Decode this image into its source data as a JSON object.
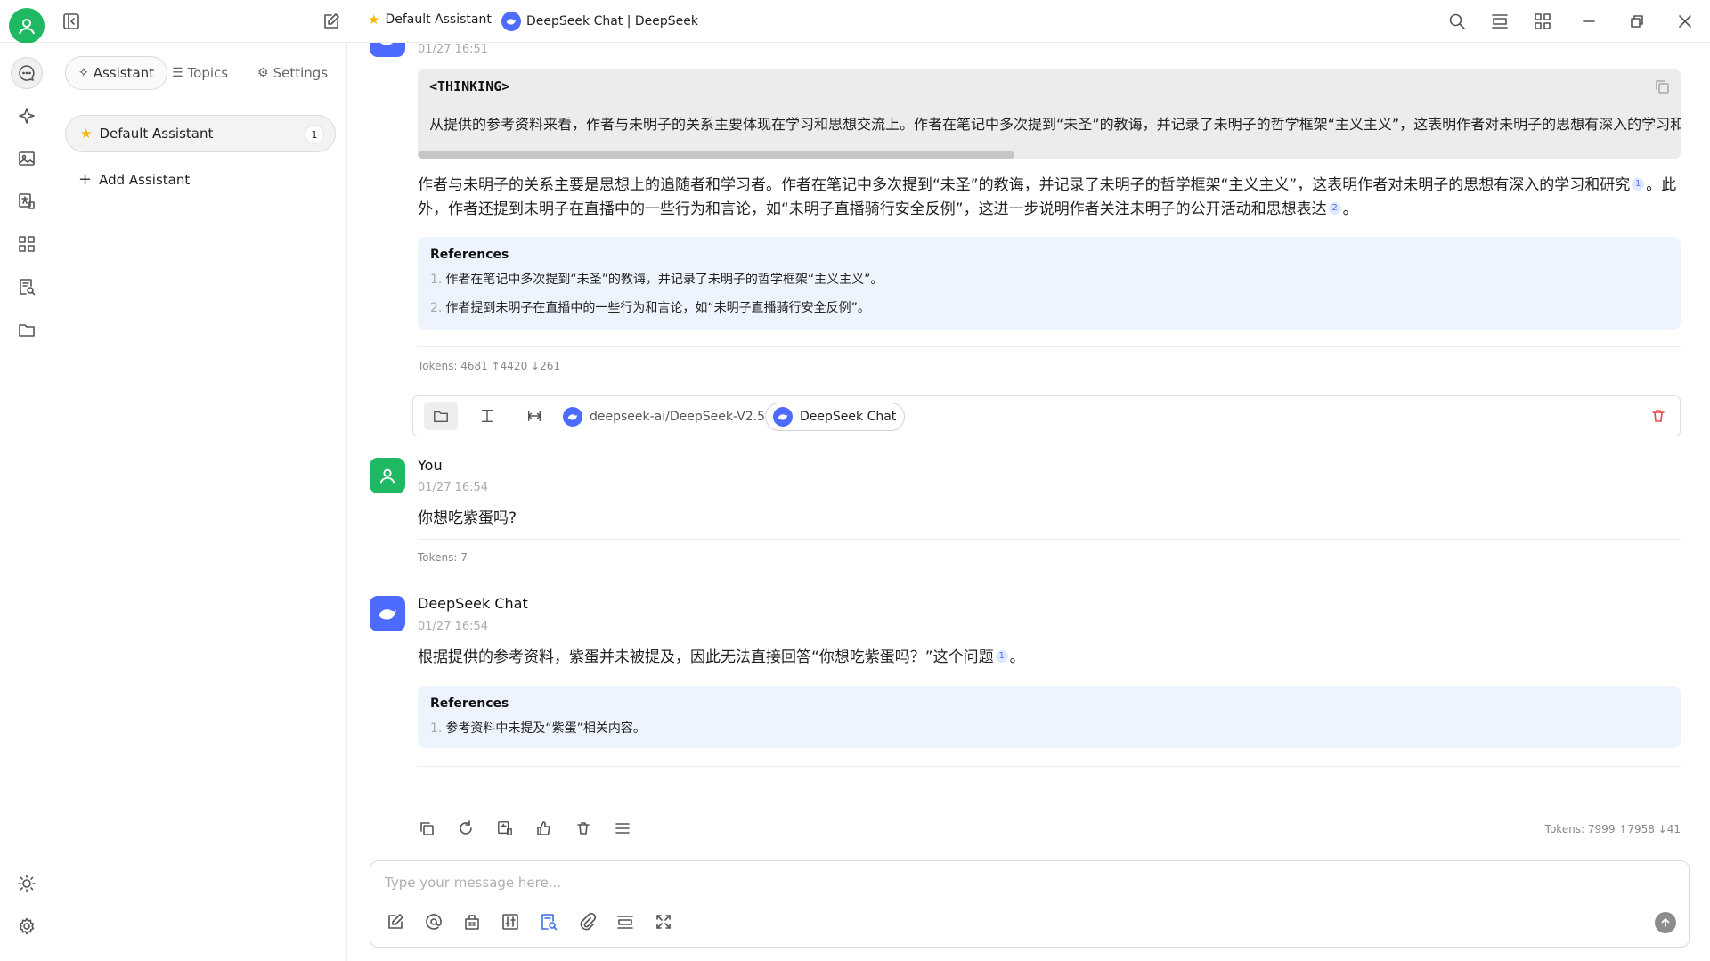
{
  "titlebar": {
    "assistant_tab": "Default Assistant",
    "chat_tab": "DeepSeek Chat | DeepSeek"
  },
  "panel": {
    "tabs": [
      {
        "label": "Assistant"
      },
      {
        "label": "Topics"
      },
      {
        "label": "Settings"
      }
    ],
    "assistant": {
      "name": "Default Assistant",
      "count": "1"
    },
    "add_label": "Add Assistant"
  },
  "messages": {
    "first": {
      "time": "01/27 16:51",
      "thinking_head": "<THINKING>",
      "thinking_text": "从提供的参考资料来看，作者与未明子的关系主要体现在学习和思想交流上。作者在笔记中多次提到“未圣”的教诲，并记录了未明子的哲学框架“主义主义”，这表明作者对未明子的思想有深入的学习和研究。",
      "body_a": "作者与未明子的关系主要是思想上的追随者和学习者。作者在笔记中多次提到“未圣”的教诲，并记录了未明子的哲学框架“主义主义”，这表明作者对未明子的思想有深入的学习和研究",
      "cite_1": "1",
      "body_b": "。此外，作者还提到未明子在直播中的一些行为和言论，如“未明子直播骑行安全反例”，这进一步说明作者关注未明子的公开活动和思想表达",
      "cite_2": "2",
      "body_c": "。",
      "refs_title": "References",
      "refs": [
        {
          "num": "1.",
          "text": "作者在笔记中多次提到“未圣”的教诲，并记录了未明子的哲学框架“主义主义”。"
        },
        {
          "num": "2.",
          "text": "作者提到未明子在直播中的一些行为和言论，如“未明子直播骑行安全反例”。"
        }
      ],
      "tokens": "Tokens: 4681 ↑4420 ↓261",
      "model_name": "deepseek-ai/DeepSeek-V2.5",
      "model_active": "DeepSeek Chat"
    },
    "user": {
      "sender": "You",
      "time": "01/27 16:54",
      "text": "你想吃紫蛋吗?",
      "tokens": "Tokens: 7"
    },
    "reply": {
      "sender": "DeepSeek Chat",
      "time": "01/27 16:54",
      "body_a": "根据提供的参考资料，紫蛋并未被提及，因此无法直接回答“你想吃紫蛋吗？”这个问题",
      "cite_1": "1",
      "body_b": "。",
      "refs_title": "References",
      "refs": [
        {
          "num": "1.",
          "text": "参考资料中未提及“紫蛋”相关内容。"
        }
      ],
      "tokens": "Tokens: 7999 ↑7958 ↓41"
    }
  },
  "input": {
    "placeholder": "Type your message here..."
  },
  "colors": {
    "accent_green": "#1fb863",
    "deepseek_blue": "#4d6bfe",
    "reference_bg": "#eef4fd"
  }
}
